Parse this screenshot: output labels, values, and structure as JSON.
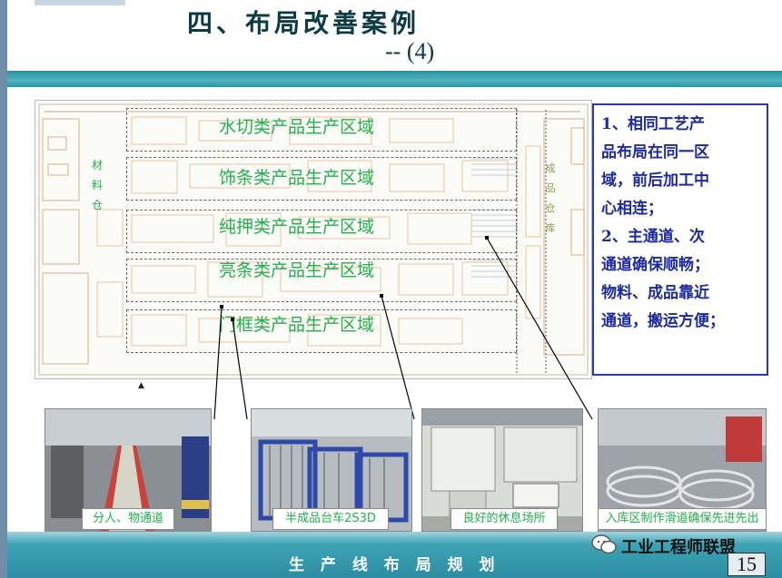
{
  "slide": {
    "title": "四、布局改善案例",
    "subtitle": "-- (4)",
    "page_number": "15",
    "footer_text": "生 产 线 布 局 规 划",
    "watermark": "工业工程师联盟"
  },
  "floor_plan": {
    "zones": [
      {
        "label": "水切类产品生产区域"
      },
      {
        "label": "饰条类产品生产区域"
      },
      {
        "label": "纯押类产品生产区域"
      },
      {
        "label": "亮条类产品生产区域"
      },
      {
        "label": "门框类产品生产区域"
      }
    ],
    "material_warehouse": "材料仓",
    "finished_warehouse": "成品仓库"
  },
  "text_box": {
    "lines": [
      "1、相同工艺产",
      "品布局在同一区",
      "域，前后加工中",
      "心相连；",
      "2、主通道、次",
      "通道确保顺畅；",
      "物料、成品靠近",
      "通道，搬运方便；"
    ]
  },
  "photos": [
    {
      "caption": "分人、物通道",
      "icon": "aisle-photo"
    },
    {
      "caption": "半成品台车2S3D",
      "icon": "cart-photo"
    },
    {
      "caption": "良好的休息场所",
      "icon": "rest-area-photo"
    },
    {
      "caption": "入库区制作滑道确保先进先出",
      "icon": "slide-rack-photo"
    }
  ],
  "colors": {
    "zone_label": "#22b14c",
    "text_box": "#1c2aa0",
    "title": "#0b3b46",
    "bar": "#2f8fa0"
  }
}
